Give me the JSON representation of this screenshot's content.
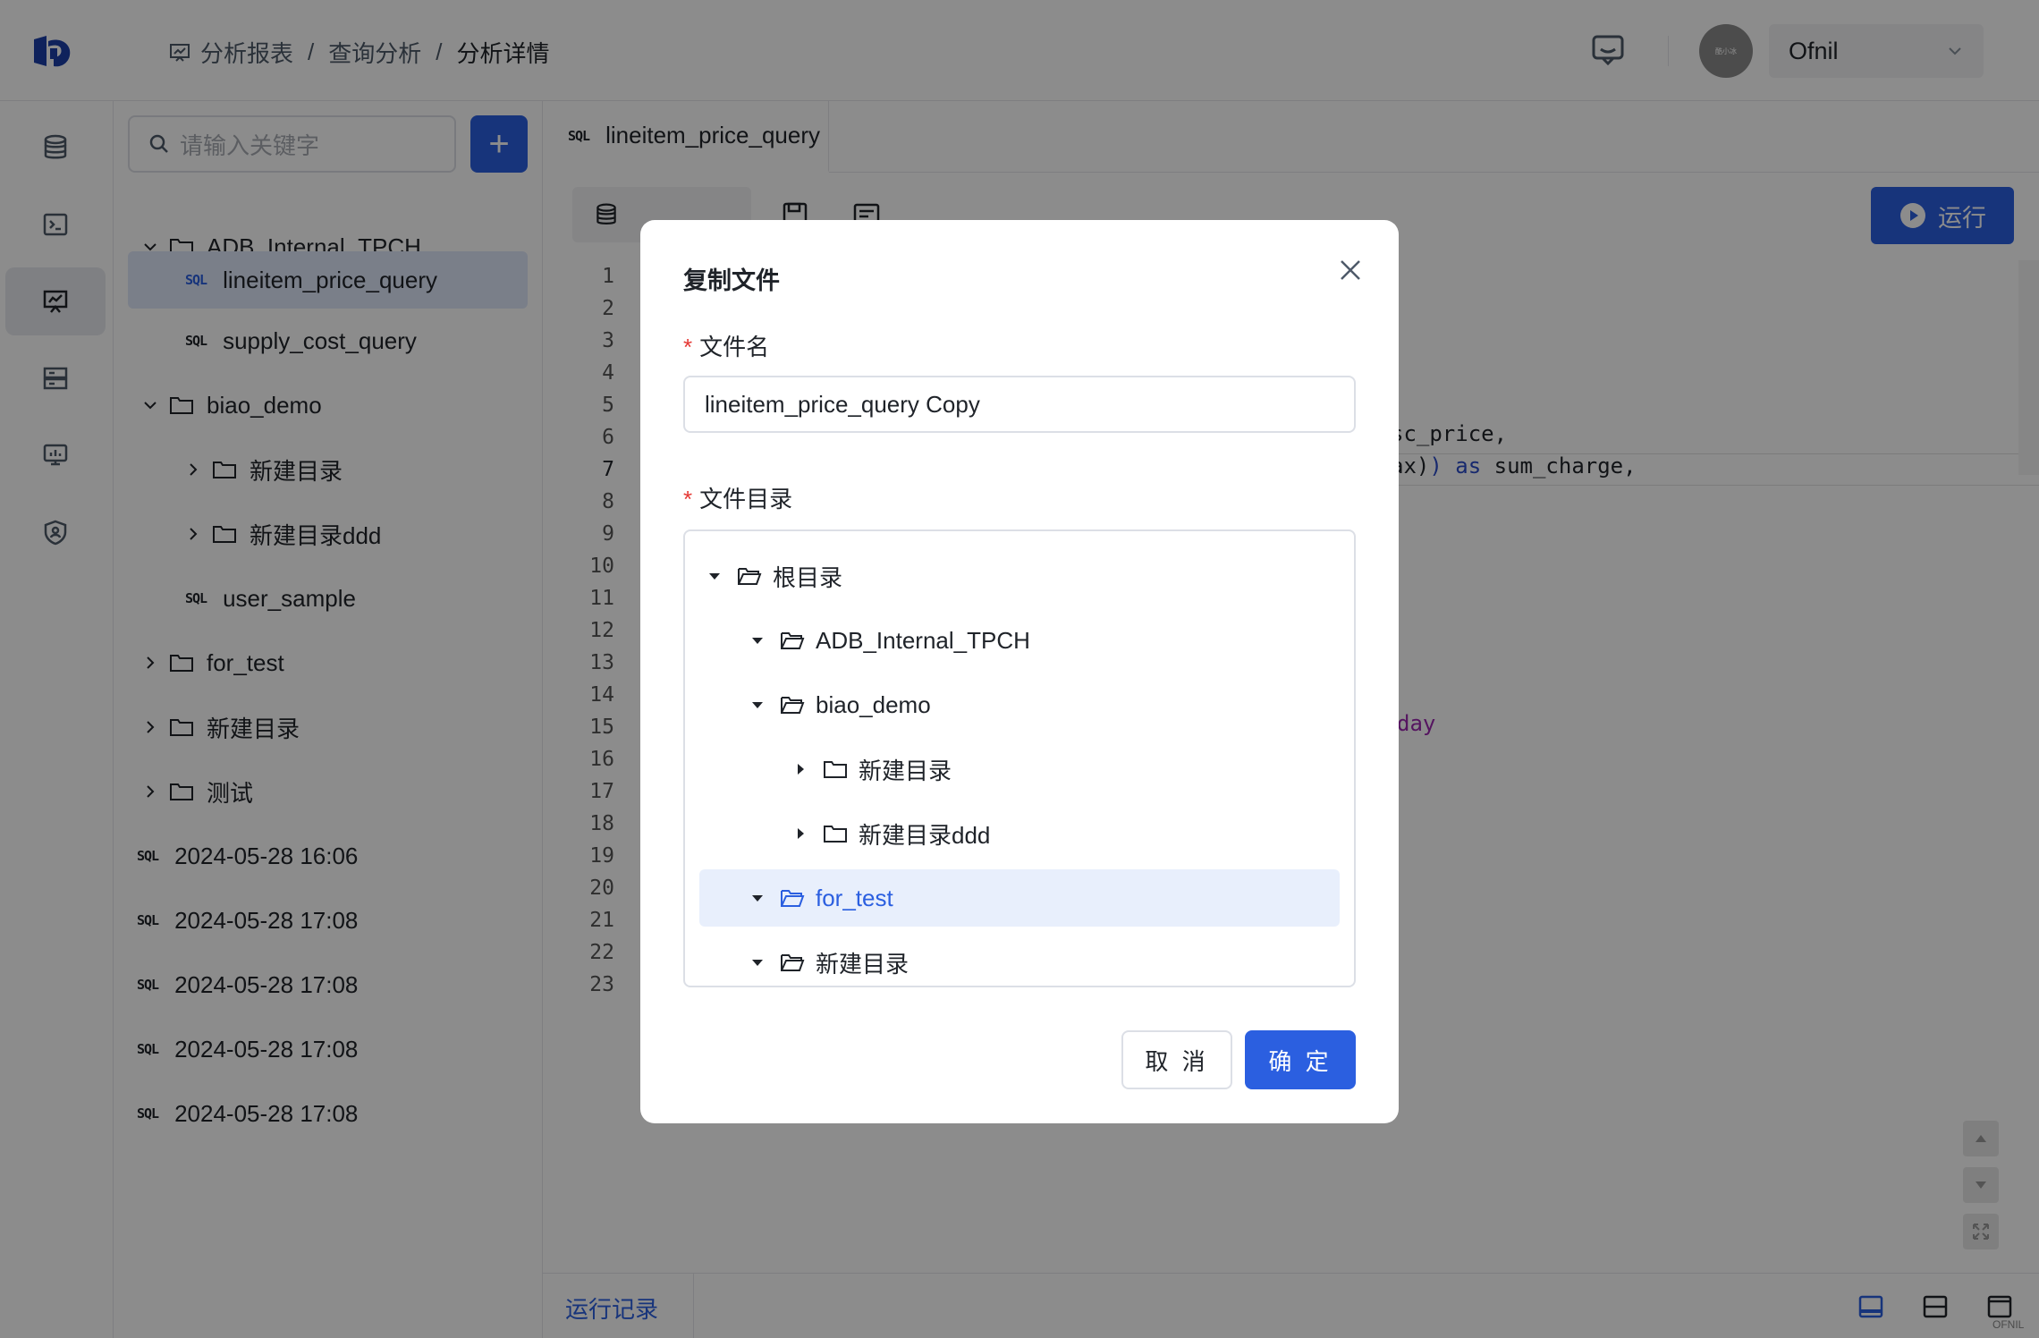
{
  "header": {
    "breadcrumb": [
      "分析报表",
      "查询分析",
      "分析详情"
    ],
    "separator": "/",
    "avatar_text": "酷小冰",
    "username": "Ofnil"
  },
  "sidebar": {
    "search_placeholder": "请输入关键字",
    "add_label": "+",
    "sql_badge": "SQL",
    "items": [
      {
        "label": "ADB_Internal_TPCH",
        "type": "folder"
      },
      {
        "label": "lineitem_price_query",
        "type": "sql"
      },
      {
        "label": "supply_cost_query",
        "type": "sql"
      },
      {
        "label": "biao_demo",
        "type": "folder"
      },
      {
        "label": "新建目录",
        "type": "folder"
      },
      {
        "label": "新建目录ddd",
        "type": "folder"
      },
      {
        "label": "user_sample",
        "type": "sql"
      },
      {
        "label": "for_test",
        "type": "folder"
      },
      {
        "label": "新建目录",
        "type": "folder"
      },
      {
        "label": "测试",
        "type": "folder"
      },
      {
        "label": "2024-05-28 16:06",
        "type": "sql"
      },
      {
        "label": "2024-05-28 17:08",
        "type": "sql"
      },
      {
        "label": "2024-05-28 17:08",
        "type": "sql"
      },
      {
        "label": "2024-05-28 17:08",
        "type": "sql"
      },
      {
        "label": "2024-05-28 17:08",
        "type": "sql"
      }
    ]
  },
  "editor": {
    "tab_label": "lineitem_price_query",
    "run_label": "运行",
    "line_numbers": [
      "1",
      "2",
      "3",
      "4",
      "5",
      "6",
      "7",
      "8",
      "9",
      "10",
      "11",
      "12",
      "13",
      "14",
      "15",
      "16",
      "17",
      "18",
      "19",
      "20",
      "21",
      "22",
      "23"
    ],
    "code_line6": "sc_price,",
    "code_line7_a": "ax)",
    "code_line7_b": ") ",
    "code_line7_kw": "as",
    "code_line7_c": " sum_charge,",
    "code_line15": "day",
    "run_log_label": "运行记录",
    "watermark": "OFNIL"
  },
  "modal": {
    "title": "复制文件",
    "required_mark": "*",
    "name_label": "文件名",
    "name_value": "lineitem_price_query Copy",
    "dir_label": "文件目录",
    "tree": [
      {
        "label": "根目录",
        "level": 0,
        "open": true
      },
      {
        "label": "ADB_Internal_TPCH",
        "level": 1,
        "open": true
      },
      {
        "label": "biao_demo",
        "level": 1,
        "open": true
      },
      {
        "label": "新建目录",
        "level": 2,
        "open": false
      },
      {
        "label": "新建目录ddd",
        "level": 2,
        "open": false
      },
      {
        "label": "for_test",
        "level": 1,
        "open": true,
        "selected": true
      },
      {
        "label": "新建目录",
        "level": 1,
        "open": true
      }
    ],
    "cancel_label": "取 消",
    "ok_label": "确 定"
  },
  "colors": {
    "primary": "#2b5fe0",
    "selected_bg": "#e8effc",
    "required": "#e53935"
  }
}
